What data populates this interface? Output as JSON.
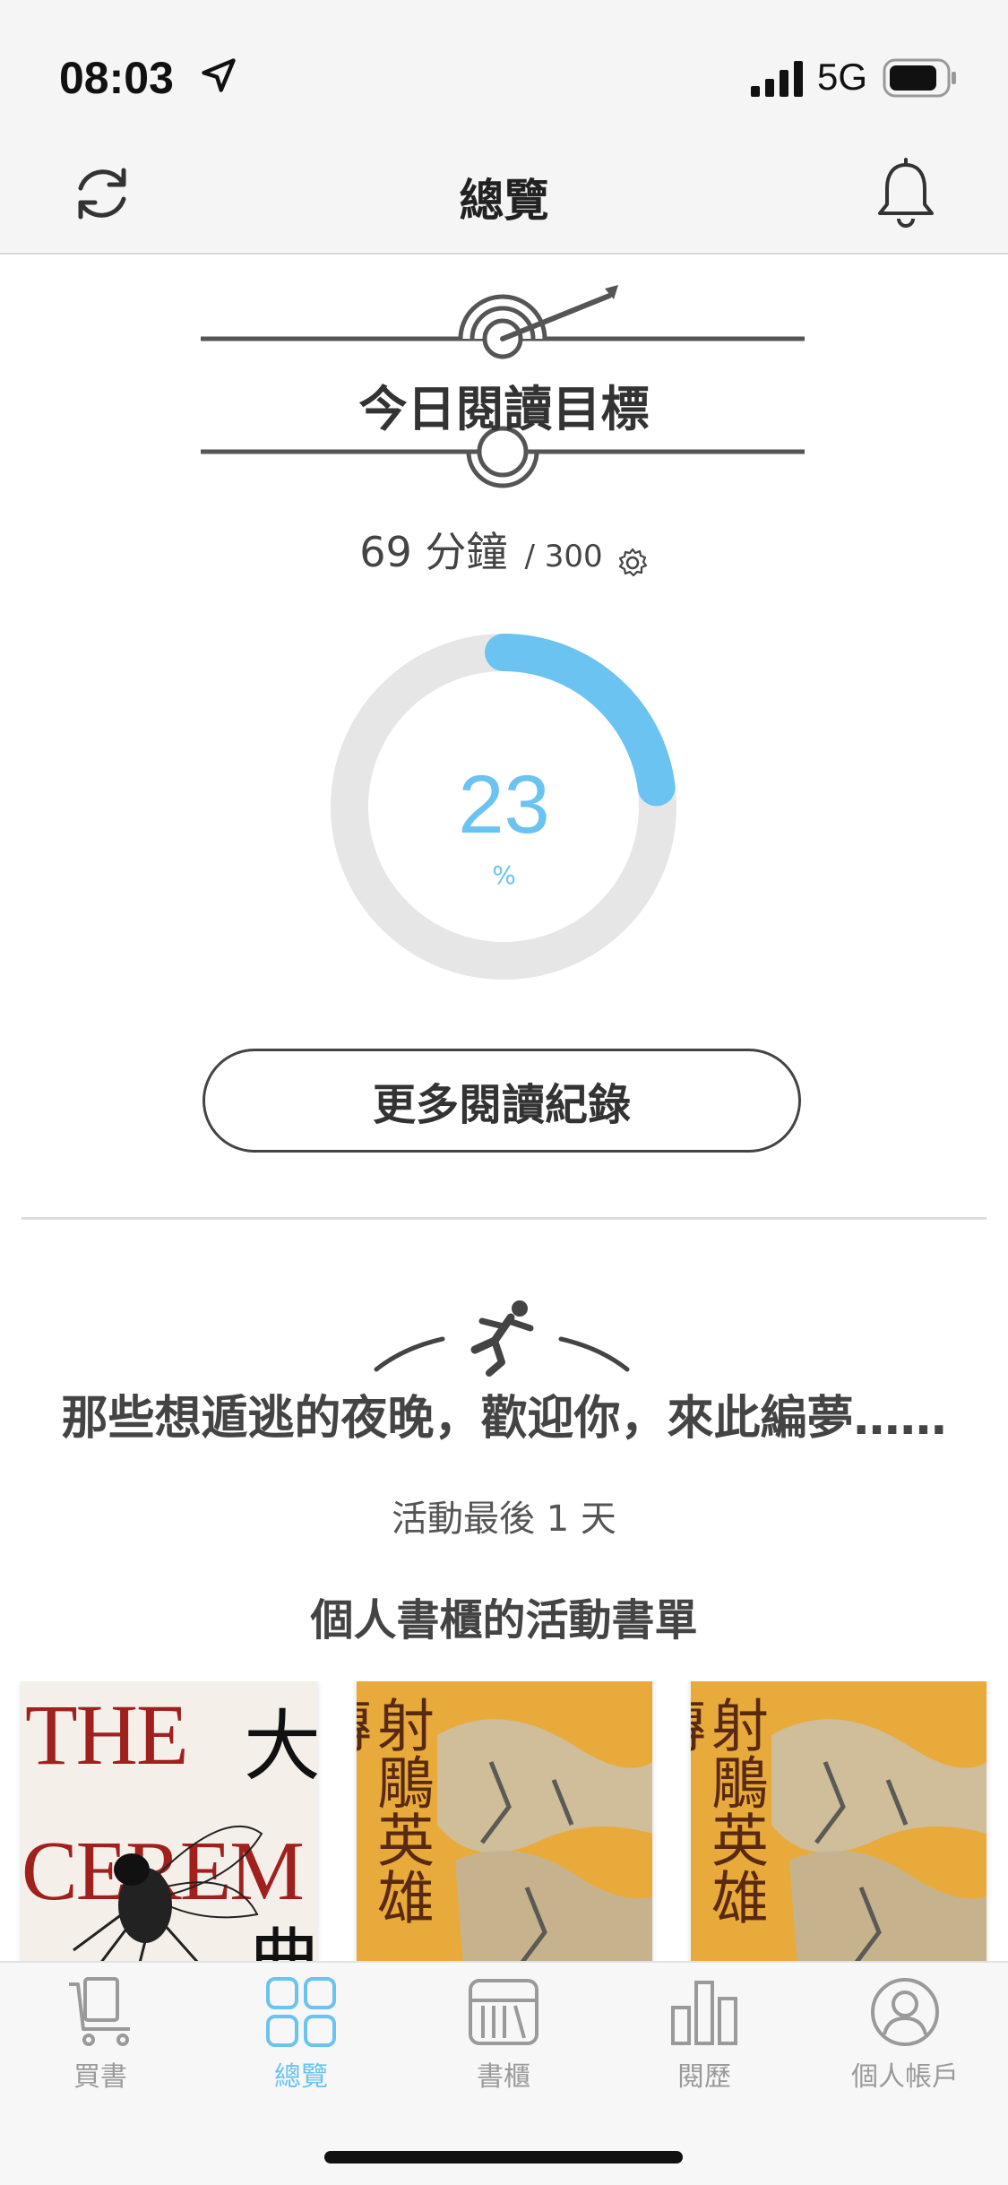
{
  "status_bar": {
    "time": "08:03",
    "network": "5G"
  },
  "header": {
    "title": "總覽"
  },
  "reading_goal": {
    "title": "今日閱讀目標",
    "minutes_read": "69 分鐘",
    "minutes_target": "/ 300",
    "percent": "23",
    "percent_unit": "%",
    "progress_fraction": 0.23,
    "more_button_label": "更多閱讀紀錄"
  },
  "campaign": {
    "title": "那些想遁逃的夜晚，歡迎你，來此編夢……",
    "days_left": "活動最後 1 天",
    "list_title": "個人書櫃的活動書單"
  },
  "books": [
    {
      "cover_title_en_1": "THE",
      "cover_title_en_2": "CEREM",
      "cover_title_cjk_1": "大",
      "cover_title_cjk_2": "典"
    },
    {
      "cover_title": "射鵰英雄傳"
    },
    {
      "cover_title": "射鵰英雄傳"
    }
  ],
  "tab_bar": {
    "tabs": [
      {
        "label": "買書",
        "icon": "cart-icon",
        "active": false
      },
      {
        "label": "總覽",
        "icon": "grid-icon",
        "active": true
      },
      {
        "label": "書櫃",
        "icon": "bookshelf-icon",
        "active": false
      },
      {
        "label": "閱歷",
        "icon": "bar-chart-icon",
        "active": false
      },
      {
        "label": "個人帳戶",
        "icon": "person-icon",
        "active": false
      }
    ]
  },
  "colors": {
    "accent": "#6ac3f0",
    "ring_track": "#e6e6e6",
    "text": "#333333"
  }
}
